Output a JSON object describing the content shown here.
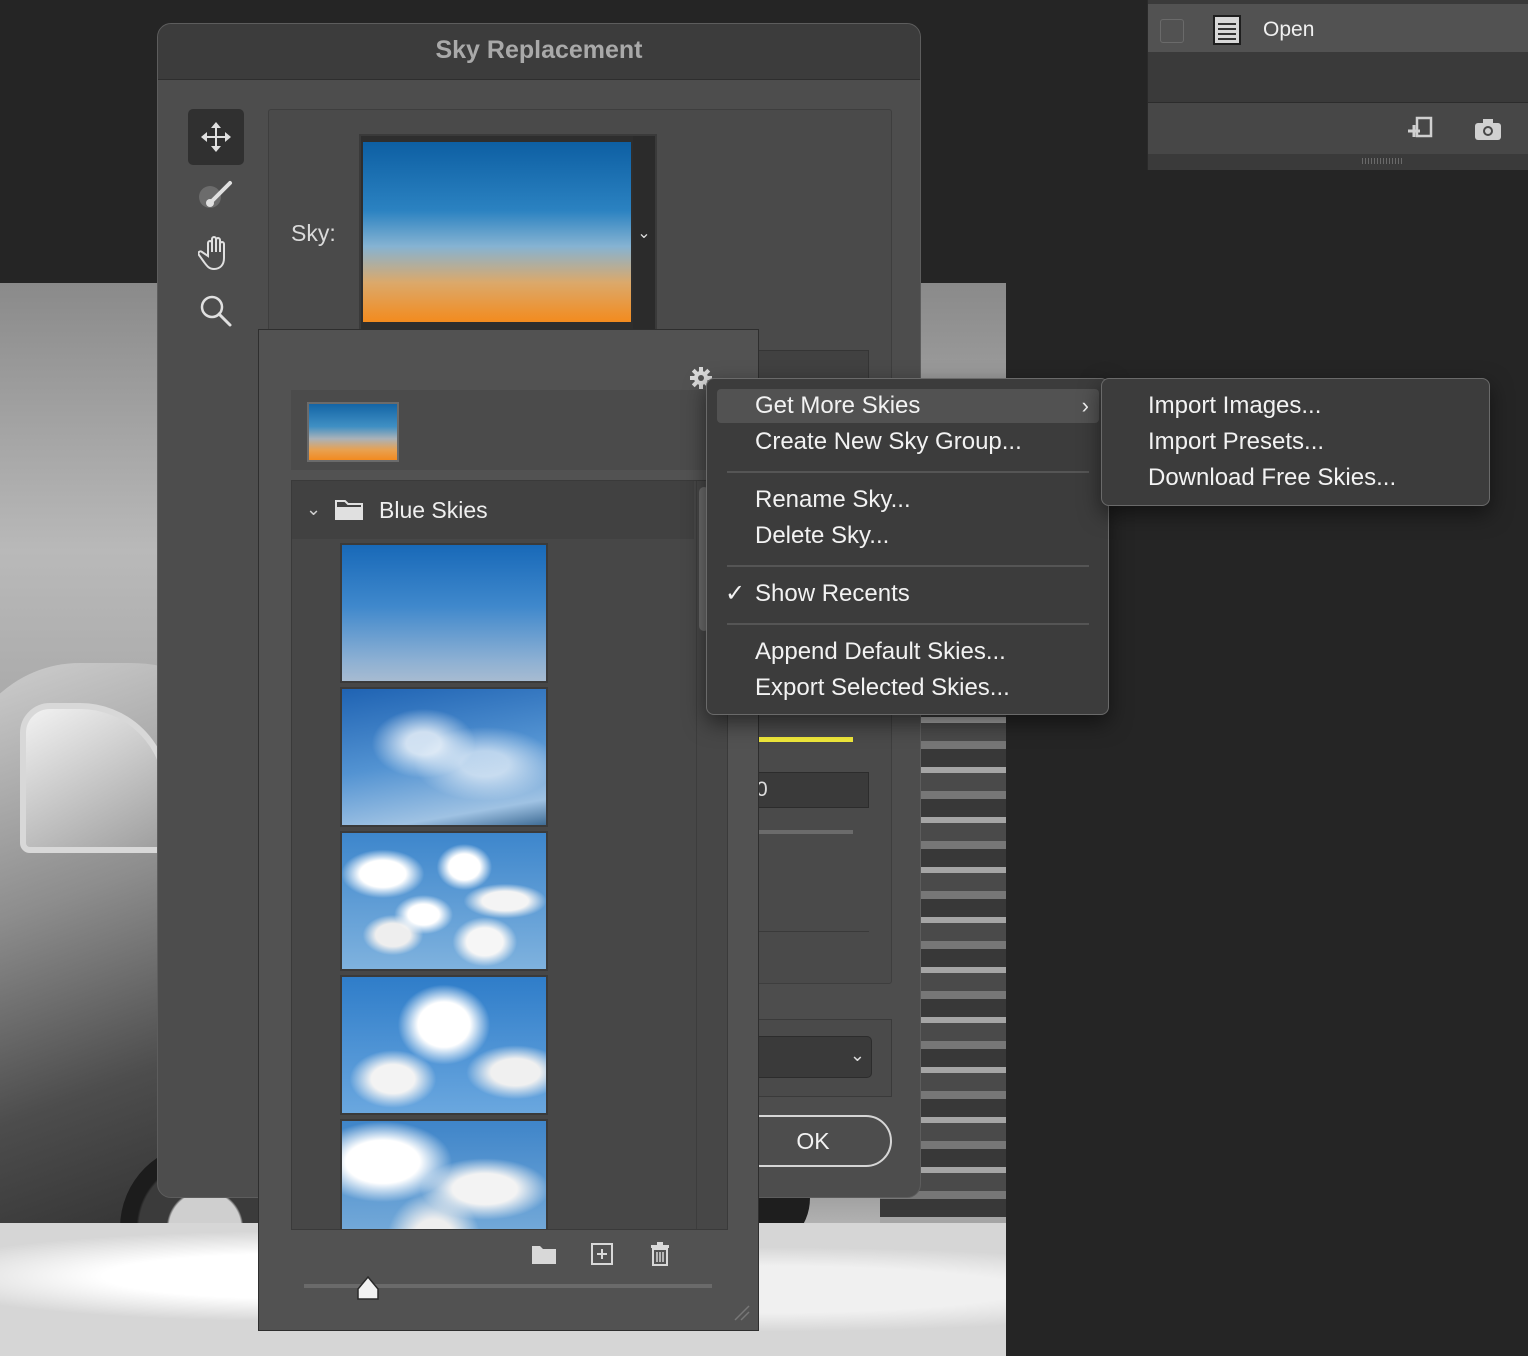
{
  "dialog": {
    "title": "Sky Replacement",
    "sky_label": "Sky:",
    "ok_label": "OK",
    "number_field_partial": "0",
    "tools": [
      "move-sky-icon",
      "sky-brush-icon",
      "hand-icon",
      "zoom-icon"
    ]
  },
  "history": {
    "item_label": "Open"
  },
  "picker": {
    "group_name": "Blue Skies",
    "group_expanded": true,
    "thumbnails": [
      "clear-blue-gradient",
      "wispy-cirrus",
      "scattered-cumulus",
      "puffy-clouds",
      "cumulus-clouds"
    ]
  },
  "menu": {
    "items": [
      {
        "label": "Get More Skies",
        "has_submenu": true,
        "highlighted": true
      },
      {
        "label": "Create New Sky Group..."
      },
      {
        "label": "Rename Sky..."
      },
      {
        "label": "Delete Sky..."
      },
      {
        "label": "Show Recents",
        "checked": true,
        "check_mark": "✓"
      },
      {
        "label": "Append Default Skies..."
      },
      {
        "label": "Export Selected Skies..."
      }
    ]
  },
  "submenu": {
    "items": [
      {
        "label": "Import Images..."
      },
      {
        "label": "Import Presets..."
      },
      {
        "label": "Download Free Skies..."
      }
    ]
  },
  "colors": {
    "accent_yellow": "#f0e93b",
    "menu_bg": "#3c3c3c",
    "panel_bg": "#4d4d4d"
  }
}
